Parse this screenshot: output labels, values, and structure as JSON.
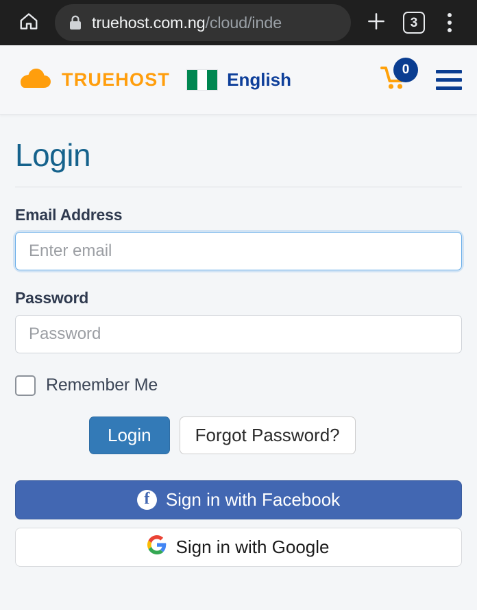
{
  "browser": {
    "home_icon": "home-icon",
    "lock_icon": "lock-icon",
    "url_domain": "truehost.com.ng",
    "url_path": "/cloud/inde",
    "new_tab_label": "+",
    "tab_count": "3",
    "menu_icon": "overflow-menu-icon"
  },
  "site_header": {
    "logo_icon": "cloud-icon",
    "brand_name": "TRUEHOST",
    "flag_icon": "nigeria-flag-icon",
    "language": "English",
    "cart_icon": "shopping-cart-icon",
    "cart_count": "0",
    "menu_icon": "hamburger-menu-icon",
    "brand_color": "#FF9E0D",
    "accent_color": "#0a3d91"
  },
  "login": {
    "title": "Login",
    "email_label": "Email Address",
    "email_value": "",
    "email_placeholder": "Enter email",
    "password_label": "Password",
    "password_value": "",
    "password_placeholder": "Password",
    "remember_label": "Remember Me",
    "remember_checked": false,
    "login_button": "Login",
    "forgot_button": "Forgot Password?",
    "facebook_button": "Sign in with Facebook",
    "facebook_icon": "facebook-icon",
    "facebook_color": "#4267b2",
    "google_button": "Sign in with Google",
    "google_icon": "google-icon",
    "title_color": "#15628c",
    "primary_color": "#337ab7"
  }
}
